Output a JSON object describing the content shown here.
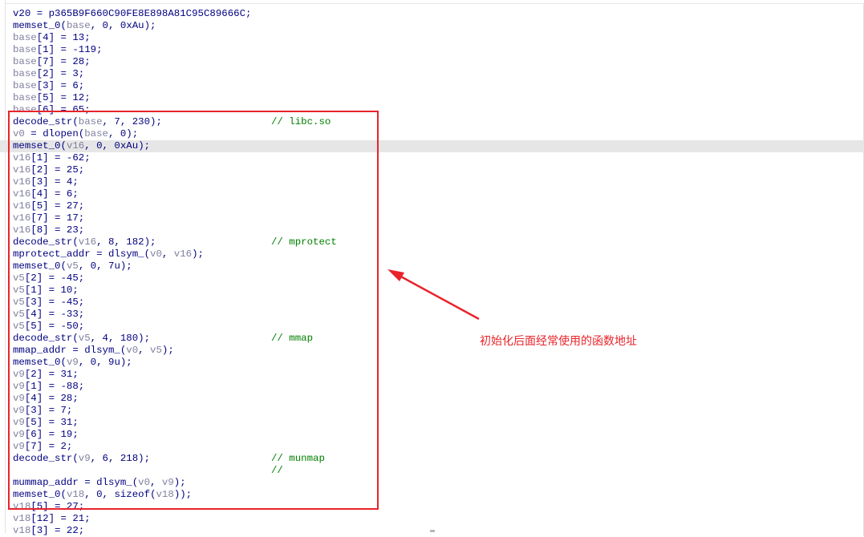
{
  "code_lines": [
    {
      "text": "v20 = p365B9F660C90FE8E898A81C95C89666C;",
      "comment": ""
    },
    {
      "text": "memset_0(base, 0, 0xAu);",
      "comment": ""
    },
    {
      "text": "base[4] = 13;",
      "comment": ""
    },
    {
      "text": "base[1] = -119;",
      "comment": ""
    },
    {
      "text": "base[7] = 28;",
      "comment": ""
    },
    {
      "text": "base[2] = 3;",
      "comment": ""
    },
    {
      "text": "base[3] = 6;",
      "comment": ""
    },
    {
      "text": "base[5] = 12;",
      "comment": ""
    },
    {
      "text": "base[6] = 65;",
      "comment": ""
    },
    {
      "text": "decode_str(base, 7, 230);",
      "comment": "// libc.so"
    },
    {
      "text": "v0 = dlopen(base, 0);",
      "comment": ""
    },
    {
      "text": "memset_0(v16, 0, 0xAu);",
      "comment": "",
      "highlighted": true
    },
    {
      "text": "v16[1] = -62;",
      "comment": ""
    },
    {
      "text": "v16[2] = 25;",
      "comment": ""
    },
    {
      "text": "v16[3] = 4;",
      "comment": ""
    },
    {
      "text": "v16[4] = 6;",
      "comment": ""
    },
    {
      "text": "v16[5] = 27;",
      "comment": ""
    },
    {
      "text": "v16[7] = 17;",
      "comment": ""
    },
    {
      "text": "v16[8] = 23;",
      "comment": ""
    },
    {
      "text": "decode_str(v16, 8, 182);",
      "comment": "// mprotect"
    },
    {
      "text": "mprotect_addr = dlsym_(v0, v16);",
      "comment": ""
    },
    {
      "text": "memset_0(v5, 0, 7u);",
      "comment": ""
    },
    {
      "text": "v5[2] = -45;",
      "comment": ""
    },
    {
      "text": "v5[1] = 10;",
      "comment": ""
    },
    {
      "text": "v5[3] = -45;",
      "comment": ""
    },
    {
      "text": "v5[4] = -33;",
      "comment": ""
    },
    {
      "text": "v5[5] = -50;",
      "comment": ""
    },
    {
      "text": "decode_str(v5, 4, 180);",
      "comment": "// mmap"
    },
    {
      "text": "mmap_addr = dlsym_(v0, v5);",
      "comment": ""
    },
    {
      "text": "memset_0(v9, 0, 9u);",
      "comment": ""
    },
    {
      "text": "v9[2] = 31;",
      "comment": ""
    },
    {
      "text": "v9[1] = -88;",
      "comment": ""
    },
    {
      "text": "v9[4] = 28;",
      "comment": ""
    },
    {
      "text": "v9[3] = 7;",
      "comment": ""
    },
    {
      "text": "v9[5] = 31;",
      "comment": ""
    },
    {
      "text": "v9[6] = 19;",
      "comment": ""
    },
    {
      "text": "v9[7] = 2;",
      "comment": ""
    },
    {
      "text": "decode_str(v9, 6, 218);",
      "comment": "// munmap"
    },
    {
      "text": "",
      "comment": "//"
    },
    {
      "text": "mummap_addr = dlsym_(v0, v9);",
      "comment": ""
    },
    {
      "text": "memset_0(v18, 0, sizeof(v18));",
      "comment": ""
    },
    {
      "text": "v18[5] = 27;",
      "comment": ""
    },
    {
      "text": "v18[12] = 21;",
      "comment": ""
    },
    {
      "text": "v18[3] = 22;",
      "comment": ""
    }
  ],
  "variable_names": [
    "base",
    "v0",
    "v5",
    "v9",
    "v16",
    "v18"
  ],
  "annotation": {
    "text": "初始化后面经常使用的函数地址",
    "color": "#e8242b"
  },
  "colors": {
    "code_default": "#000080",
    "variable": "#8080a0",
    "comment": "#008000",
    "highlight_line": "#e6e6e6",
    "annotation_red": "#e8242b"
  }
}
